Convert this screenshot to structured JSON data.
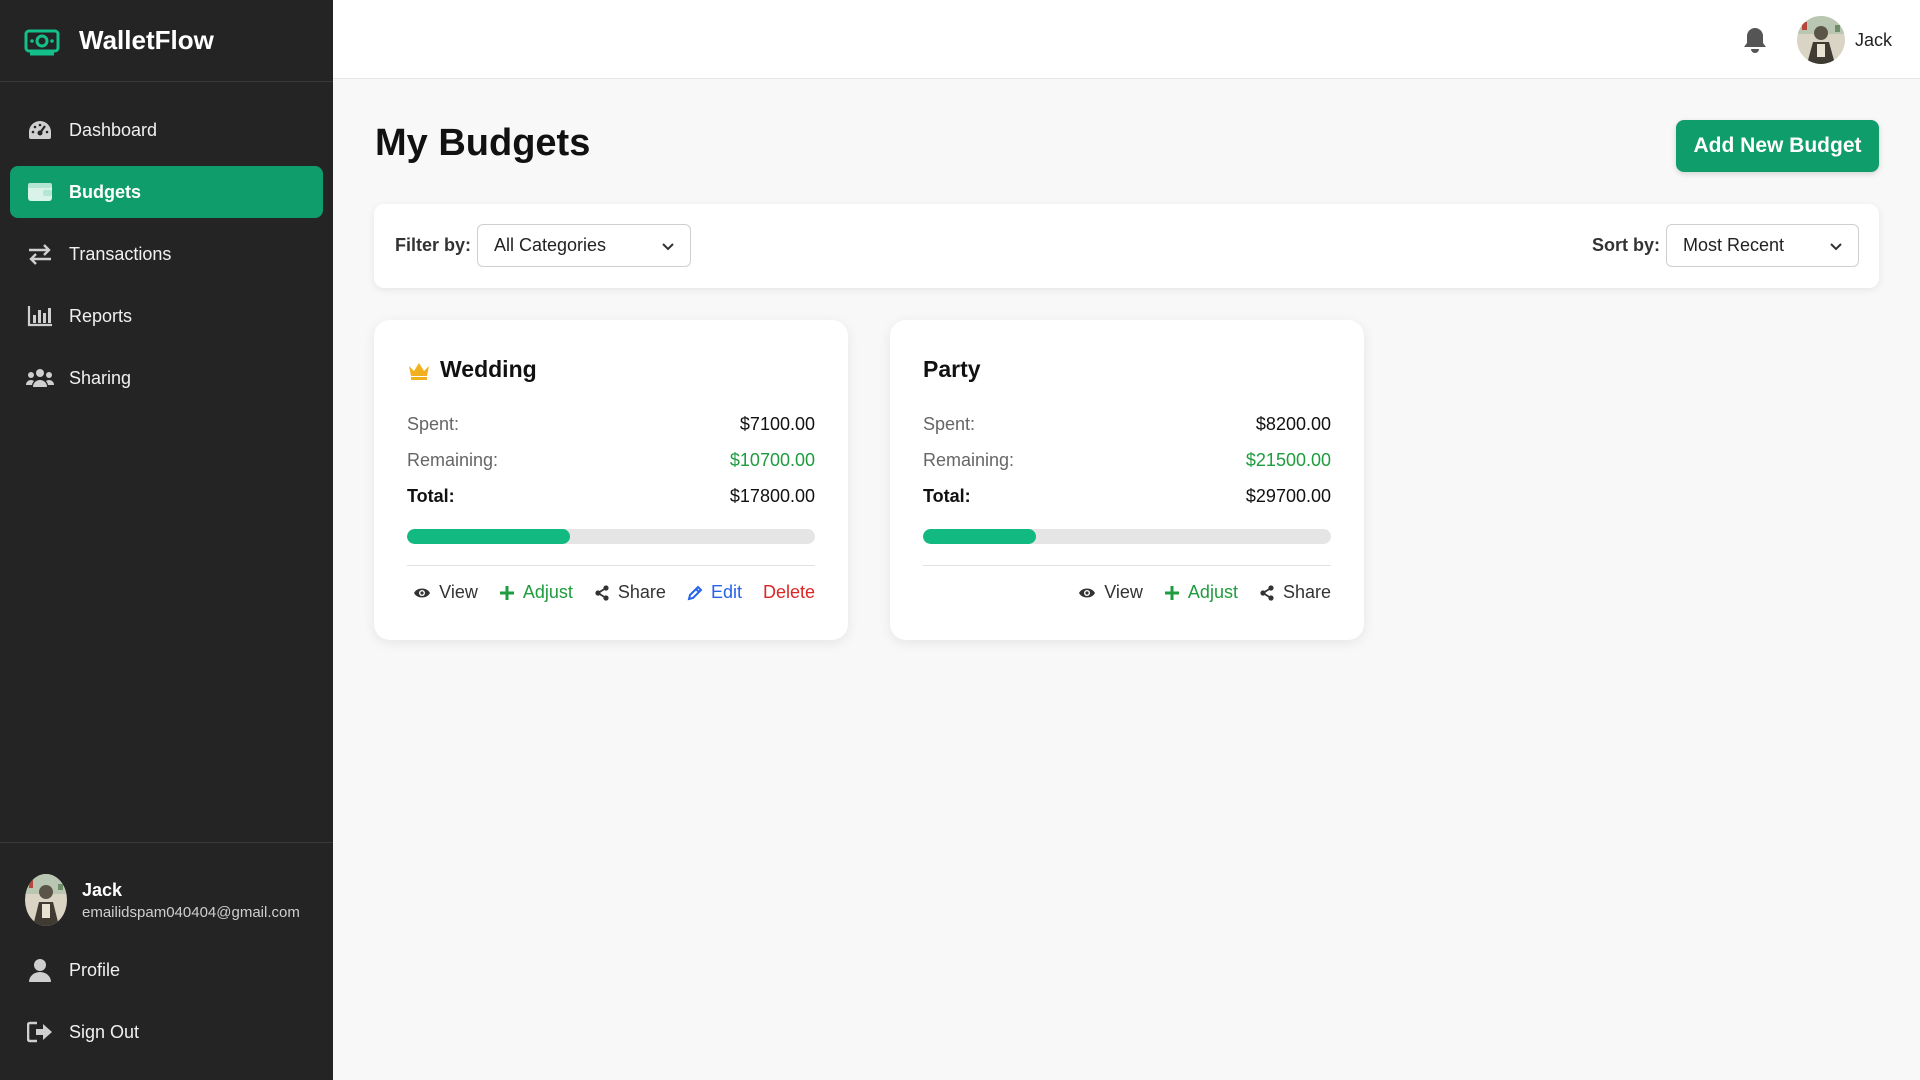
{
  "brand": {
    "name": "WalletFlow",
    "logo_icon": "money-icon"
  },
  "sidebar": {
    "items": [
      {
        "label": "Dashboard",
        "icon": "gauge-icon",
        "active": false
      },
      {
        "label": "Budgets",
        "icon": "wallet-icon",
        "active": true
      },
      {
        "label": "Transactions",
        "icon": "transfer-arrows-icon",
        "active": false
      },
      {
        "label": "Reports",
        "icon": "bar-chart-icon",
        "active": false
      },
      {
        "label": "Sharing",
        "icon": "users-icon",
        "active": false
      }
    ],
    "user": {
      "name": "Jack",
      "email": "emailidspam040404@gmail.com"
    },
    "bottom": [
      {
        "label": "Profile",
        "icon": "user-icon"
      },
      {
        "label": "Sign Out",
        "icon": "sign-out-icon"
      }
    ]
  },
  "topbar": {
    "user_name": "Jack",
    "bell_icon": "bell-icon"
  },
  "page": {
    "title": "My Budgets",
    "add_button": "Add New Budget"
  },
  "filters": {
    "filter_label": "Filter by:",
    "filter_value": "All Categories",
    "sort_label": "Sort by:",
    "sort_value": "Most Recent"
  },
  "labels": {
    "spent": "Spent:",
    "remaining": "Remaining:",
    "total": "Total:"
  },
  "budgets": [
    {
      "name": "Wedding",
      "owner_icon": "crown-icon",
      "spent": "$7100.00",
      "remaining": "$10700.00",
      "total": "$17800.00",
      "progress": 0.399,
      "actions": {
        "view": "View",
        "adjust": "Adjust",
        "share": "Share",
        "edit": "Edit",
        "delete": "Delete"
      }
    },
    {
      "name": "Party",
      "spent": "$8200.00",
      "remaining": "$21500.00",
      "total": "$29700.00",
      "progress": 0.276,
      "actions": {
        "view": "View",
        "adjust": "Adjust",
        "share": "Share"
      }
    }
  ],
  "colors": {
    "accent": "#0f9d6b",
    "sidebar_bg": "#242424",
    "remaining_green": "#1e9c3e",
    "progress": "#12b981",
    "edit_blue": "#2563eb",
    "delete_red": "#dc2626"
  }
}
